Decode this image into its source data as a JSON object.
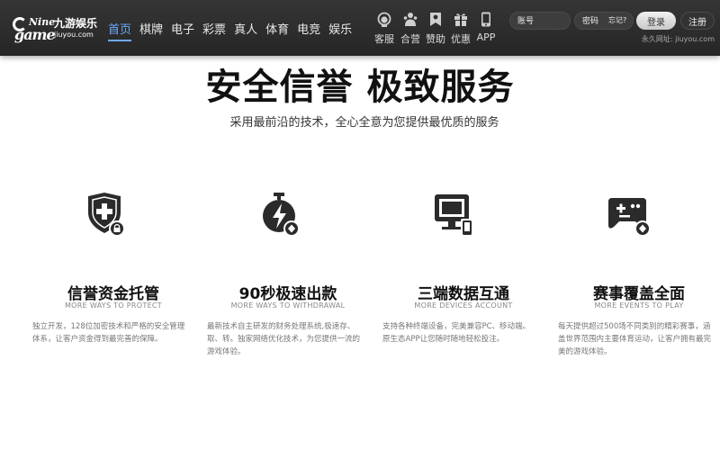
{
  "brand": {
    "logo_small": "Nine",
    "logo_large": "game",
    "name_cn": "九游娱乐",
    "domain": "jiuyou.com"
  },
  "nav": [
    {
      "label": "首页",
      "active": true
    },
    {
      "label": "棋牌",
      "active": false
    },
    {
      "label": "电子",
      "active": false
    },
    {
      "label": "彩票",
      "active": false
    },
    {
      "label": "真人",
      "active": false
    },
    {
      "label": "体育",
      "active": false
    },
    {
      "label": "电竞",
      "active": false
    },
    {
      "label": "娱乐",
      "active": false
    }
  ],
  "quick_links": [
    {
      "label": "客服",
      "icon": "headset-icon"
    },
    {
      "label": "合营",
      "icon": "partners-icon"
    },
    {
      "label": "赞助",
      "icon": "sponsor-badge-icon"
    },
    {
      "label": "优惠",
      "icon": "gift-icon"
    },
    {
      "label": "APP",
      "icon": "phone-icon"
    }
  ],
  "login": {
    "account_placeholder": "账号",
    "password_placeholder": "密码",
    "forgot_label": "忘记?",
    "login_label": "登录",
    "register_label": "注册",
    "site_url": "永久网址: jiuyou.com"
  },
  "hero": {
    "title": "安全信誉 极致服务",
    "subtitle": "采用最前沿的技术，全心全意为您提供最优质的服务"
  },
  "features": [
    {
      "icon": "shield-plus-lock-icon",
      "title": "信誉资金托管",
      "subtitle": "MORE WAYS TO PROTECT",
      "description": "独立开发，128位加密技术和严格的安全管理体系，让客户资金得到最完善的保障。"
    },
    {
      "icon": "stopwatch-lightning-icon",
      "title": "90秒极速出款",
      "subtitle": "MORE WAYS TO WITHDRAWAL",
      "description": "最新技术自主研发的财务处理系统,极速存、取、转。独家网络优化技术，为您提供一流的游戏体验。"
    },
    {
      "icon": "monitor-phone-icon",
      "title": "三端数据互通",
      "subtitle": "MORE DEVICES ACCOUNT",
      "description": "支持各种终端设备，完美兼容PC、移动端。原生态APP让您随时随地轻松投注。"
    },
    {
      "icon": "gamepad-icon",
      "title": "赛事覆盖全面",
      "subtitle": "MORE EVENTS TO PLAY",
      "description": "每天提供超过500场不同类别的精彩赛事，涵盖世界范围内主要体育运动，让客户拥有最完美的游戏体验。"
    }
  ],
  "colors": {
    "header_bg": "#2d2d2d",
    "nav_active": "#6fa8ff",
    "icon_dark": "#2b2b2b"
  }
}
